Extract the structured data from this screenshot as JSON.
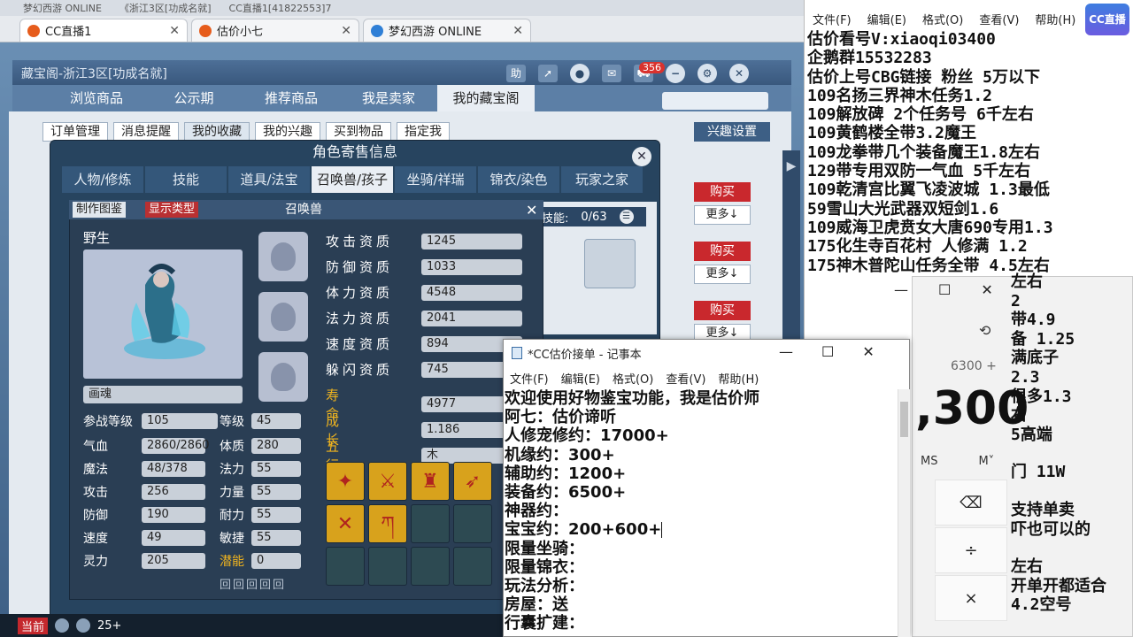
{
  "os_top": [
    "梦幻西游 ONLINE",
    "《浙江3区[功成名就]",
    "CC直播1[41822553]7"
  ],
  "browser_tabs": [
    {
      "label": "CC直播1",
      "active": true
    },
    {
      "label": "估价小七",
      "active": false
    },
    {
      "label": "梦幻西游 ONLINE",
      "active": false
    }
  ],
  "shop": {
    "title": "藏宝阁-浙江3区[功成名就]",
    "help_label": "助",
    "badge": "356",
    "nav": [
      "浏览商品",
      "公示期",
      "推荐商品",
      "我是卖家",
      "我的藏宝阁"
    ],
    "active_nav": 4,
    "subnav": [
      "订单管理",
      "消息提醒",
      "我的收藏",
      "我的兴趣",
      "买到物品",
      "指定我"
    ],
    "interest_settings": "兴趣设置",
    "buy_label": "购买",
    "more_label": "更多↓"
  },
  "dialog": {
    "title": "角色寄售信息",
    "tabs": [
      "人物/修炼",
      "技能",
      "道具/法宝",
      "召唤兽/孩子",
      "坐骑/祥瑞",
      "锦衣/染色",
      "玩家之家"
    ],
    "active_tab": 3,
    "skill_label": "技能:",
    "skill_count": "0/63"
  },
  "pet": {
    "btn_make": "制作图鉴",
    "btn_show": "显示类型",
    "title": "召唤兽",
    "type": "野生",
    "name": "画魂",
    "left_stats": [
      {
        "k": "参战等级",
        "v": "105"
      },
      {
        "k": "气血",
        "v": "2860/2860"
      },
      {
        "k": "魔法",
        "v": "48/378"
      },
      {
        "k": "攻击",
        "v": "256"
      },
      {
        "k": "防御",
        "v": "190"
      },
      {
        "k": "速度",
        "v": "49"
      },
      {
        "k": "灵力",
        "v": "205"
      }
    ],
    "mid_stats": [
      {
        "k": "等级",
        "v": "45"
      },
      {
        "k": "体质",
        "v": "280"
      },
      {
        "k": "法力",
        "v": "55"
      },
      {
        "k": "力量",
        "v": "55"
      },
      {
        "k": "耐力",
        "v": "55"
      },
      {
        "k": "敏捷",
        "v": "55"
      },
      {
        "k": "潜能",
        "v": "0"
      }
    ],
    "aptitudes": [
      {
        "k": "攻击资质",
        "v": "1245"
      },
      {
        "k": "防御资质",
        "v": "1033"
      },
      {
        "k": "体力资质",
        "v": "4548"
      },
      {
        "k": "法力资质",
        "v": "2041"
      },
      {
        "k": "速度资质",
        "v": "894"
      },
      {
        "k": "躲闪资质",
        "v": "745"
      },
      {
        "k": "寿命",
        "v": "4977"
      },
      {
        "k": "成长",
        "v": "1.186"
      },
      {
        "k": "五行",
        "v": "木"
      }
    ]
  },
  "bottom": {
    "status": "当前",
    "count": "25+"
  },
  "notepad_front": {
    "title": "*CC估价接单 - 记事本",
    "menu": [
      "文件(F)",
      "编辑(E)",
      "格式(O)",
      "查看(V)",
      "帮助(H)"
    ],
    "lines": [
      "欢迎使用好物鉴宝功能，我是估价师",
      "阿七：估价谛听",
      "人修宠修约：17000+",
      "机缘约：300+",
      "辅助约：1200+",
      "装备约：6500+",
      "神器约：",
      "宝宝约：200+600+",
      "限量坐骑：",
      "限量锦衣：",
      "玩法分析：",
      "房屋：送",
      "行囊扩建："
    ]
  },
  "notepad_right": {
    "menu": [
      "文件(F)",
      "编辑(E)",
      "格式(O)",
      "查看(V)",
      "帮助(H)"
    ],
    "lines": [
      "估价看号V:xiaoqi03400",
      "企鹅群15532283",
      "估价上号CBG链接 粉丝 5万以下",
      "109名扬三界神木任务1.2",
      "109解放碑 2个任务号 6千左右",
      "109黄鹤楼全带3.2魔王",
      "109龙拳带几个装备魔王1.8左右",
      "129带专用双防一气血 5千左右",
      "109乾清宫比翼飞凌波城 1.3最低",
      "59雪山大光武器双短剑1.6",
      "109威海卫虎贲女大唐690专用1.3",
      "175化生寺百花村 人修满 1.2",
      "175神木普陀山任务全带 4.5左右"
    ],
    "frag": [
      "左右",
      "2",
      "带4.9",
      "备  1.25",
      "满底子",
      "2.3",
      "很多1.3",
      "右",
      "5高端",
      "门 11W",
      "支持单卖",
      "吓也可以的",
      "左右",
      "开单开都适合",
      "4.2空号"
    ],
    "logo": "CC直播"
  },
  "calculator": {
    "expr": "6300 +",
    "value": ",300",
    "mem": [
      "MS",
      "M˅"
    ],
    "keys": [
      "⌫",
      "÷",
      "×"
    ]
  }
}
